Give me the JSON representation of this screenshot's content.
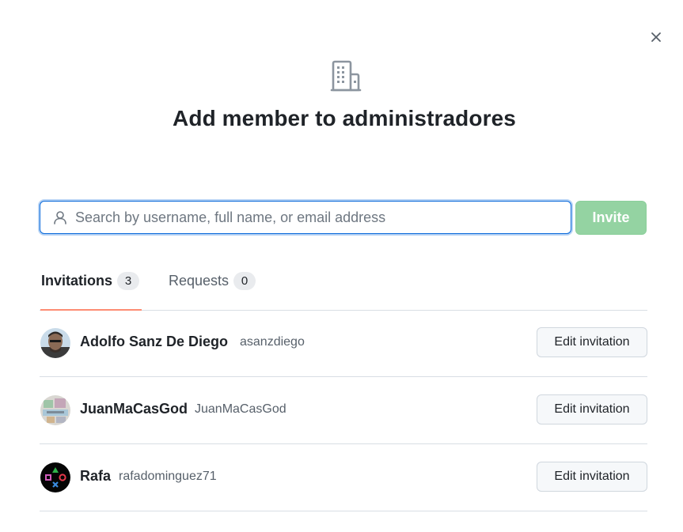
{
  "dialog": {
    "title": "Add member to administradores",
    "close_icon": "close-icon",
    "header_icon": "organization-icon"
  },
  "search": {
    "placeholder": "Search by username, full name, or email address",
    "value": "",
    "icon": "person-icon"
  },
  "invite_button": {
    "label": "Invite",
    "disabled": true,
    "color": "#94d3a2"
  },
  "tabs": [
    {
      "label": "Invitations",
      "count": "3",
      "selected": true
    },
    {
      "label": "Requests",
      "count": "0",
      "selected": false
    }
  ],
  "members": [
    {
      "name": "Adolfo Sanz De Diego",
      "login": "asanzdiego",
      "action": "Edit invitation"
    },
    {
      "name": "JuanMaCasGod",
      "login": "JuanMaCasGod",
      "action": "Edit invitation"
    },
    {
      "name": "Rafa",
      "login": "rafadominguez71",
      "action": "Edit invitation"
    }
  ],
  "colors": {
    "accent_underline": "#fd8c73",
    "focus_border": "#0969da",
    "text_primary": "#1f2328",
    "text_muted": "#57606a"
  }
}
